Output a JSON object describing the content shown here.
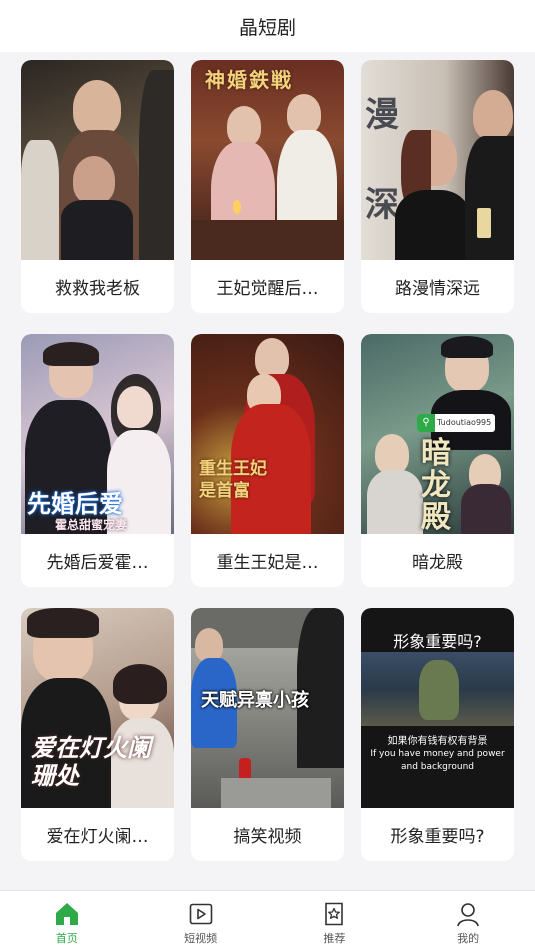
{
  "header": {
    "title": "晶短剧"
  },
  "cards": [
    {
      "title": "救救我老板",
      "poster_colors": [
        "#3a3a3a",
        "#b8a27a"
      ]
    },
    {
      "title": "王妃觉醒后…",
      "overlay_text": "神婚鉄戦",
      "poster_colors": [
        "#5a2a20",
        "#d9b08a"
      ]
    },
    {
      "title": "路漫情深远",
      "overlay_text": "漫 深",
      "poster_colors": [
        "#c9c2b8",
        "#3c3230"
      ]
    },
    {
      "title": "先婚后爱霍…",
      "overlay_text": "先婚后爱",
      "overlay_subtext": "霍总甜蜜宠妻",
      "poster_colors": [
        "#6a6a8a",
        "#e6d8e4"
      ]
    },
    {
      "title": "重生王妃是…",
      "overlay_text": "重生王妃是首富",
      "poster_colors": [
        "#7a1a16",
        "#c8a040"
      ]
    },
    {
      "title": "暗龙殿",
      "overlay_text": "暗龙殿",
      "badge_text": "Tudoutiao995",
      "poster_colors": [
        "#2a4a4a",
        "#6a8a7a"
      ]
    },
    {
      "title": "爱在灯火阑…",
      "overlay_text": "爱在灯火阑珊处",
      "poster_colors": [
        "#c0b0a0",
        "#5a3a36"
      ]
    },
    {
      "title": "搞笑视频",
      "overlay_text": "天赋异禀小孩",
      "poster_colors": [
        "#8a8a88",
        "#3a3a3a"
      ]
    },
    {
      "title": "形象重要吗?",
      "overlay_text": "形象重要吗?",
      "overlay_subtext": "如果你有钱有权有背景",
      "overlay_subtext_en": "If you have money and power and background",
      "poster_colors": [
        "#1c1c1c",
        "#3a4a5a"
      ]
    }
  ],
  "tabbar": {
    "items": [
      {
        "label": "首页",
        "icon": "home-icon",
        "active": true
      },
      {
        "label": "短视频",
        "icon": "play-icon",
        "active": false
      },
      {
        "label": "推荐",
        "icon": "star-icon",
        "active": false
      },
      {
        "label": "我的",
        "icon": "user-icon",
        "active": false
      }
    ]
  },
  "colors": {
    "accent": "#2eaa48",
    "background": "#f4f4f6",
    "card": "#ffffff"
  }
}
